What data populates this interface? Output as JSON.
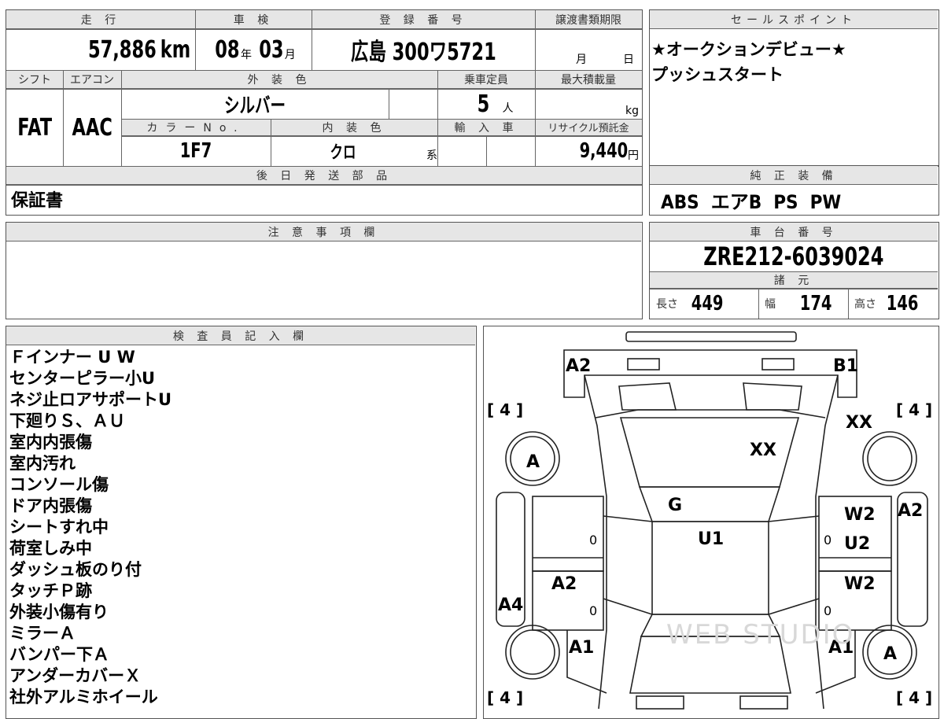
{
  "top": {
    "mileage_header": "走 行",
    "mileage_value": "57,886",
    "mileage_unit": "km",
    "inspection_header": "車 検",
    "inspection_year": "08",
    "inspection_year_unit": "年",
    "inspection_month": "03",
    "inspection_month_unit": "月",
    "registration_header": "登 録 番 号",
    "registration_value": "広島 300ワ5721",
    "transfer_header": "譲渡書類期限",
    "transfer_month_unit": "月",
    "transfer_day_unit": "日",
    "shift_header": "シフト",
    "shift_value": "FAT",
    "ac_header": "エアコン",
    "ac_value": "AAC",
    "exterior_color_header": "外 装 色",
    "exterior_color_value": "シルバー",
    "capacity_header": "乗車定員",
    "capacity_value": "5",
    "capacity_unit": "人",
    "max_load_header": "最大積載量",
    "max_load_unit": "kg",
    "color_no_header": "カラーNo.",
    "color_no_value": "1F7",
    "interior_color_header": "内 装 色",
    "interior_color_value": "クロ",
    "interior_color_suffix": "系",
    "import_header": "輸 入 車",
    "recycle_header": "リサイクル預託金",
    "recycle_value": "9,440",
    "recycle_unit": "円",
    "later_parts_header": "後 日 発 送 部 品",
    "later_parts_value": "保証書"
  },
  "sales": {
    "header": "セールスポイント",
    "lines": [
      "★オークションデビュー★",
      "プッシュスタート"
    ]
  },
  "equipment": {
    "header": "純 正 装 備",
    "value": "ABS  エアB  PS  PW"
  },
  "notes": {
    "header": "注 意 事 項 欄"
  },
  "chassis": {
    "header": "車 台 番 号",
    "value": "ZRE212-6039024",
    "specs_header": "諸 元",
    "length_label": "長さ",
    "length_value": "449",
    "width_label": "幅",
    "width_value": "174",
    "height_label": "高さ",
    "height_value": "146"
  },
  "inspector": {
    "header": "検 査 員 記 入 欄",
    "items": [
      "Ｆインナー U W",
      "センターピラー小U",
      "ネジ止ロアサポートU",
      "下廻りＳ、ＡＵ",
      "室内内張傷",
      "室内汚れ",
      "コンソール傷",
      "ドア内張傷",
      "シートすれ中",
      "荷室しみ中",
      "ダッシュ板のり付",
      "タッチＰ跡",
      "外装小傷有り",
      "ミラーＡ",
      "バンパー下Ａ",
      "アンダーカバーＸ",
      "社外アルミホイール"
    ]
  },
  "diagram": {
    "labels": {
      "front_left": "A2",
      "front_right": "B1",
      "hood": "XX",
      "front_right_fender": "XX",
      "windshield": "G",
      "roof": "U1",
      "front_right_door": "W2",
      "front_right_pillar": "U2",
      "rear_left_door": "A2",
      "rear_right_door": "W2",
      "right_edge": "A2",
      "left_quarter": "A4",
      "rear_left": "A1",
      "rear_right": "A1",
      "wheel_fl": "A",
      "wheel_rr": "A"
    },
    "tire_depth": [
      "4",
      "4",
      "4",
      "4"
    ],
    "door_zero": [
      "0",
      "0",
      "0",
      "0"
    ],
    "watermark": "WEB STUDIO"
  }
}
